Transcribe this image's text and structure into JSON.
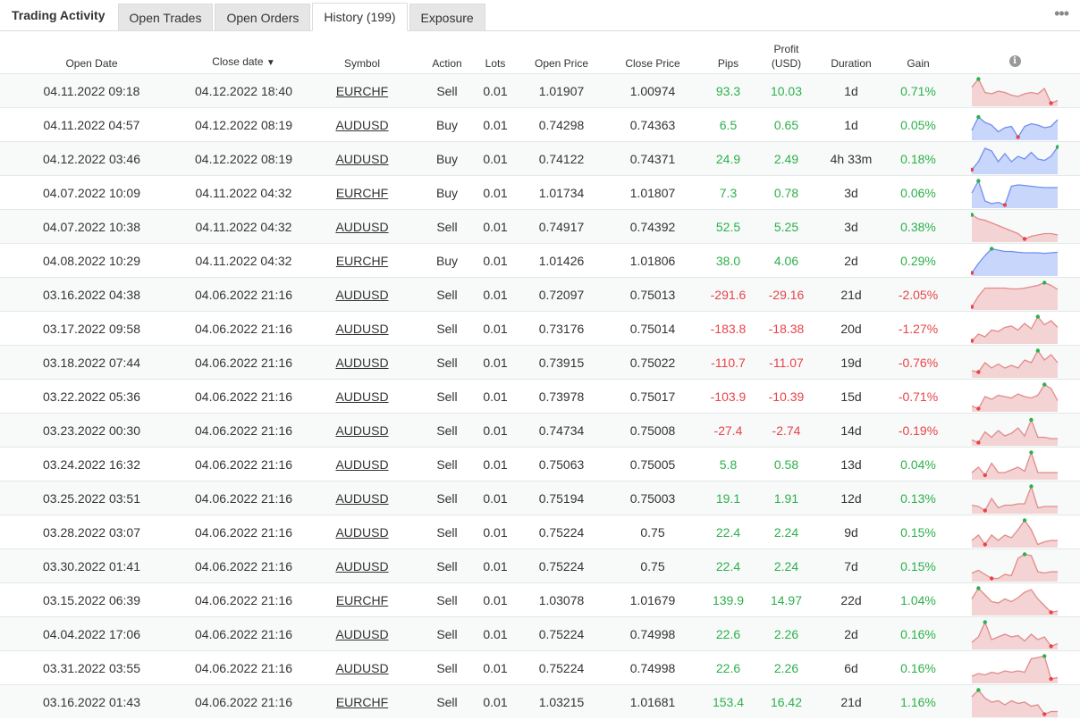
{
  "panel_title": "Trading Activity",
  "tabs": [
    "Open Trades",
    "Open Orders",
    "History (199)",
    "Exposure"
  ],
  "active_tab": 2,
  "more_icon": "ellipsis-icon",
  "columns": {
    "open_date": "Open Date",
    "close_date": "Close date",
    "sort_indicator": "▼",
    "symbol": "Symbol",
    "action": "Action",
    "lots": "Lots",
    "open_price": "Open Price",
    "close_price": "Close Price",
    "pips": "Pips",
    "profit_line1": "Profit",
    "profit_line2": "(USD)",
    "duration": "Duration",
    "gain": "Gain",
    "info_glyph": "i"
  },
  "colors": {
    "positive": "#2db04b",
    "negative": "#e8434a",
    "spark_pos_fill": "#c9d6fb",
    "spark_pos_line": "#6f8ff0",
    "spark_neg_fill": "#f3d3d3",
    "spark_neg_line": "#e48a8a"
  },
  "rows": [
    {
      "open": "04.11.2022 09:18",
      "close": "04.12.2022 18:40",
      "symbol": "EURCHF",
      "action": "Sell",
      "lots": "0.01",
      "open_price": "1.01907",
      "close_price": "1.00974",
      "pips": "93.3",
      "profit": "10.03",
      "duration": "1d",
      "gain": "0.71%",
      "positive": true,
      "spark": [
        0.35,
        0.05,
        0.55,
        0.6,
        0.5,
        0.55,
        0.65,
        0.7,
        0.6,
        0.55,
        0.6,
        0.4,
        0.95,
        0.85
      ],
      "dir": "neg"
    },
    {
      "open": "04.11.2022 04:57",
      "close": "04.12.2022 08:19",
      "symbol": "AUDUSD",
      "action": "Buy",
      "lots": "0.01",
      "open_price": "0.74298",
      "close_price": "0.74363",
      "pips": "6.5",
      "profit": "0.65",
      "duration": "1d",
      "gain": "0.05%",
      "positive": true,
      "spark": [
        0.7,
        0.2,
        0.4,
        0.5,
        0.75,
        0.6,
        0.55,
        0.95,
        0.55,
        0.45,
        0.5,
        0.6,
        0.55,
        0.3
      ],
      "dir": "pos"
    },
    {
      "open": "04.12.2022 03:46",
      "close": "04.12.2022 08:19",
      "symbol": "AUDUSD",
      "action": "Buy",
      "lots": "0.01",
      "open_price": "0.74122",
      "close_price": "0.74371",
      "pips": "24.9",
      "profit": "2.49",
      "duration": "4h 33m",
      "gain": "0.18%",
      "positive": true,
      "spark": [
        0.9,
        0.6,
        0.1,
        0.2,
        0.6,
        0.3,
        0.6,
        0.4,
        0.5,
        0.25,
        0.5,
        0.55,
        0.4,
        0.05
      ],
      "dir": "pos"
    },
    {
      "open": "04.07.2022 10:09",
      "close": "04.11.2022 04:32",
      "symbol": "EURCHF",
      "action": "Buy",
      "lots": "0.01",
      "open_price": "1.01734",
      "close_price": "1.01807",
      "pips": "7.3",
      "profit": "0.78",
      "duration": "3d",
      "gain": "0.06%",
      "positive": true,
      "spark": [
        0.5,
        0.05,
        0.8,
        0.9,
        0.85,
        0.95,
        0.25,
        0.2,
        0.22,
        0.25,
        0.28,
        0.3,
        0.3,
        0.3
      ],
      "dir": "pos"
    },
    {
      "open": "04.07.2022 10:38",
      "close": "04.11.2022 04:32",
      "symbol": "AUDUSD",
      "action": "Sell",
      "lots": "0.01",
      "open_price": "0.74917",
      "close_price": "0.74392",
      "pips": "52.5",
      "profit": "5.25",
      "duration": "3d",
      "gain": "0.38%",
      "positive": true,
      "spark": [
        0.05,
        0.2,
        0.25,
        0.35,
        0.45,
        0.55,
        0.65,
        0.75,
        0.95,
        0.85,
        0.8,
        0.75,
        0.75,
        0.8
      ],
      "dir": "neg"
    },
    {
      "open": "04.08.2022 10:29",
      "close": "04.11.2022 04:32",
      "symbol": "EURCHF",
      "action": "Buy",
      "lots": "0.01",
      "open_price": "1.01426",
      "close_price": "1.01806",
      "pips": "38.0",
      "profit": "4.06",
      "duration": "2d",
      "gain": "0.29%",
      "positive": true,
      "spark": [
        0.95,
        0.6,
        0.3,
        0.05,
        0.1,
        0.15,
        0.15,
        0.18,
        0.2,
        0.2,
        0.2,
        0.22,
        0.2,
        0.18
      ],
      "dir": "pos"
    },
    {
      "open": "03.16.2022 04:38",
      "close": "04.06.2022 21:16",
      "symbol": "AUDUSD",
      "action": "Sell",
      "lots": "0.01",
      "open_price": "0.72097",
      "close_price": "0.75013",
      "pips": "-291.6",
      "profit": "-29.16",
      "duration": "21d",
      "gain": "-2.05%",
      "positive": false,
      "spark": [
        0.95,
        0.55,
        0.25,
        0.25,
        0.25,
        0.25,
        0.28,
        0.28,
        0.25,
        0.2,
        0.15,
        0.05,
        0.15,
        0.3
      ],
      "dir": "neg"
    },
    {
      "open": "03.17.2022 09:58",
      "close": "04.06.2022 21:16",
      "symbol": "AUDUSD",
      "action": "Sell",
      "lots": "0.01",
      "open_price": "0.73176",
      "close_price": "0.75014",
      "pips": "-183.8",
      "profit": "-18.38",
      "duration": "20d",
      "gain": "-1.27%",
      "positive": false,
      "spark": [
        0.95,
        0.7,
        0.8,
        0.55,
        0.6,
        0.45,
        0.4,
        0.55,
        0.3,
        0.5,
        0.05,
        0.35,
        0.2,
        0.45
      ],
      "dir": "neg"
    },
    {
      "open": "03.18.2022 07:44",
      "close": "04.06.2022 21:16",
      "symbol": "AUDUSD",
      "action": "Sell",
      "lots": "0.01",
      "open_price": "0.73915",
      "close_price": "0.75022",
      "pips": "-110.7",
      "profit": "-11.07",
      "duration": "19d",
      "gain": "-0.76%",
      "positive": false,
      "spark": [
        0.8,
        0.85,
        0.5,
        0.7,
        0.55,
        0.7,
        0.6,
        0.7,
        0.4,
        0.5,
        0.05,
        0.4,
        0.2,
        0.5
      ],
      "dir": "neg"
    },
    {
      "open": "03.22.2022 05:36",
      "close": "04.06.2022 21:16",
      "symbol": "AUDUSD",
      "action": "Sell",
      "lots": "0.01",
      "open_price": "0.73978",
      "close_price": "0.75017",
      "pips": "-103.9",
      "profit": "-10.39",
      "duration": "15d",
      "gain": "-0.71%",
      "positive": false,
      "spark": [
        0.85,
        0.95,
        0.5,
        0.6,
        0.45,
        0.5,
        0.55,
        0.4,
        0.5,
        0.55,
        0.45,
        0.05,
        0.2,
        0.65
      ],
      "dir": "neg"
    },
    {
      "open": "03.23.2022 00:30",
      "close": "04.06.2022 21:16",
      "symbol": "AUDUSD",
      "action": "Sell",
      "lots": "0.01",
      "open_price": "0.74734",
      "close_price": "0.75008",
      "pips": "-27.4",
      "profit": "-2.74",
      "duration": "14d",
      "gain": "-0.19%",
      "positive": false,
      "spark": [
        0.85,
        0.95,
        0.55,
        0.75,
        0.5,
        0.7,
        0.6,
        0.4,
        0.7,
        0.1,
        0.75,
        0.75,
        0.8,
        0.8
      ],
      "dir": "neg"
    },
    {
      "open": "03.24.2022 16:32",
      "close": "04.06.2022 21:16",
      "symbol": "AUDUSD",
      "action": "Sell",
      "lots": "0.01",
      "open_price": "0.75063",
      "close_price": "0.75005",
      "pips": "5.8",
      "profit": "0.58",
      "duration": "13d",
      "gain": "0.04%",
      "positive": true,
      "spark": [
        0.8,
        0.6,
        0.9,
        0.45,
        0.8,
        0.8,
        0.7,
        0.6,
        0.75,
        0.05,
        0.8,
        0.8,
        0.8,
        0.8
      ],
      "dir": "neg"
    },
    {
      "open": "03.25.2022 03:51",
      "close": "04.06.2022 21:16",
      "symbol": "AUDUSD",
      "action": "Sell",
      "lots": "0.01",
      "open_price": "0.75194",
      "close_price": "0.75003",
      "pips": "19.1",
      "profit": "1.91",
      "duration": "12d",
      "gain": "0.13%",
      "positive": true,
      "spark": [
        0.75,
        0.8,
        0.95,
        0.5,
        0.85,
        0.75,
        0.75,
        0.7,
        0.7,
        0.05,
        0.85,
        0.8,
        0.8,
        0.8
      ],
      "dir": "neg"
    },
    {
      "open": "03.28.2022 03:07",
      "close": "04.06.2022 21:16",
      "symbol": "AUDUSD",
      "action": "Sell",
      "lots": "0.01",
      "open_price": "0.75224",
      "close_price": "0.75",
      "pips": "22.4",
      "profit": "2.24",
      "duration": "9d",
      "gain": "0.15%",
      "positive": true,
      "spark": [
        0.8,
        0.6,
        0.95,
        0.6,
        0.8,
        0.6,
        0.7,
        0.4,
        0.05,
        0.4,
        0.95,
        0.85,
        0.8,
        0.8
      ],
      "dir": "neg"
    },
    {
      "open": "03.30.2022 01:41",
      "close": "04.06.2022 21:16",
      "symbol": "AUDUSD",
      "action": "Sell",
      "lots": "0.01",
      "open_price": "0.75224",
      "close_price": "0.75",
      "pips": "22.4",
      "profit": "2.24",
      "duration": "7d",
      "gain": "0.15%",
      "positive": true,
      "spark": [
        0.75,
        0.65,
        0.8,
        0.95,
        0.95,
        0.8,
        0.85,
        0.2,
        0.05,
        0.1,
        0.7,
        0.75,
        0.7,
        0.7
      ],
      "dir": "neg"
    },
    {
      "open": "03.15.2022 06:39",
      "close": "04.06.2022 21:16",
      "symbol": "EURCHF",
      "action": "Sell",
      "lots": "0.01",
      "open_price": "1.03078",
      "close_price": "1.01679",
      "pips": "139.9",
      "profit": "14.97",
      "duration": "22d",
      "gain": "1.04%",
      "positive": true,
      "spark": [
        0.45,
        0.05,
        0.3,
        0.55,
        0.6,
        0.45,
        0.55,
        0.4,
        0.2,
        0.1,
        0.45,
        0.7,
        0.95,
        0.9
      ],
      "dir": "neg"
    },
    {
      "open": "04.04.2022 17:06",
      "close": "04.06.2022 21:16",
      "symbol": "AUDUSD",
      "action": "Sell",
      "lots": "0.01",
      "open_price": "0.75224",
      "close_price": "0.74998",
      "pips": "22.6",
      "profit": "2.26",
      "duration": "2d",
      "gain": "0.16%",
      "positive": true,
      "spark": [
        0.8,
        0.6,
        0.05,
        0.7,
        0.6,
        0.5,
        0.6,
        0.55,
        0.75,
        0.5,
        0.7,
        0.6,
        0.95,
        0.85
      ],
      "dir": "neg"
    },
    {
      "open": "03.31.2022 03:55",
      "close": "04.06.2022 21:16",
      "symbol": "AUDUSD",
      "action": "Sell",
      "lots": "0.01",
      "open_price": "0.75224",
      "close_price": "0.74998",
      "pips": "22.6",
      "profit": "2.26",
      "duration": "6d",
      "gain": "0.16%",
      "positive": true,
      "spark": [
        0.8,
        0.7,
        0.75,
        0.65,
        0.7,
        0.6,
        0.65,
        0.6,
        0.65,
        0.15,
        0.1,
        0.05,
        0.9,
        0.85
      ],
      "dir": "neg"
    },
    {
      "open": "03.16.2022 01:43",
      "close": "04.06.2022 21:16",
      "symbol": "EURCHF",
      "action": "Sell",
      "lots": "0.01",
      "open_price": "1.03215",
      "close_price": "1.01681",
      "pips": "153.4",
      "profit": "16.42",
      "duration": "21d",
      "gain": "1.16%",
      "positive": true,
      "spark": [
        0.3,
        0.05,
        0.35,
        0.5,
        0.45,
        0.6,
        0.45,
        0.55,
        0.5,
        0.65,
        0.6,
        0.95,
        0.85,
        0.85
      ],
      "dir": "neg"
    }
  ]
}
